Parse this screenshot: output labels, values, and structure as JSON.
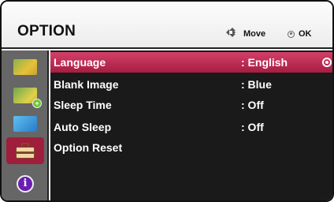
{
  "header": {
    "title": "OPTION",
    "move_label": "Move",
    "ok_label": "OK"
  },
  "sidebar": {
    "items": [
      {
        "name": "picture",
        "icon": "picture-icon"
      },
      {
        "name": "picture-settings",
        "icon": "picture-plus-icon"
      },
      {
        "name": "screen",
        "icon": "screen-icon"
      },
      {
        "name": "option",
        "icon": "briefcase-icon",
        "active": true
      },
      {
        "name": "info",
        "icon": "info-icon",
        "glyph": "i"
      }
    ]
  },
  "menu": {
    "rows": [
      {
        "label": "Language",
        "value": ": English",
        "selected": true
      },
      {
        "label": "Blank Image",
        "value": ": Blue"
      },
      {
        "label": "Sleep Time",
        "value": ": Off"
      },
      {
        "label": "Auto Sleep",
        "value": ": Off"
      },
      {
        "label": "Option Reset",
        "value": ""
      }
    ]
  },
  "colors": {
    "selected_row": "#c0304f",
    "sidebar_active": "#a01e3c",
    "menu_bg": "#1a1a1a",
    "sidebar_bg": "#666666"
  }
}
